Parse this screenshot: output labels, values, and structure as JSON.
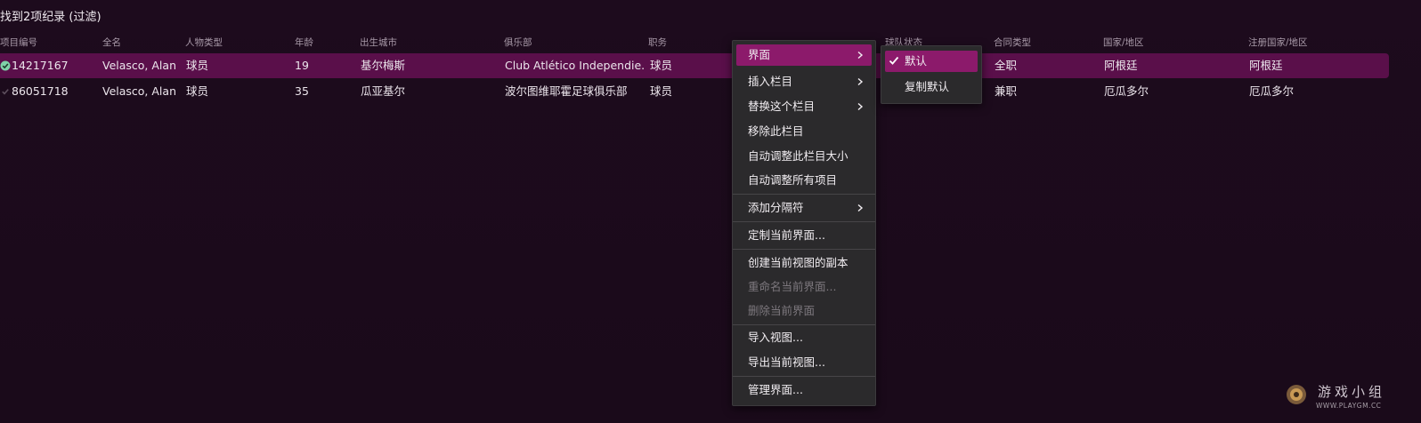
{
  "result_count": "找到2项纪录 (过滤)",
  "columns": [
    {
      "label": "项目编号"
    },
    {
      "label": "全名"
    },
    {
      "label": "人物类型"
    },
    {
      "label": "年龄"
    },
    {
      "label": "出生城市"
    },
    {
      "label": "俱乐部"
    },
    {
      "label": "职务"
    },
    {
      "label": "球队状态"
    },
    {
      "label": "合同类型"
    },
    {
      "label": "国家/地区"
    },
    {
      "label": "注册国家/地区"
    }
  ],
  "rows": [
    {
      "id": "14217167",
      "name": "Velasco, Alan",
      "type": "球员",
      "age": "19",
      "city": "基尔梅斯",
      "club": "Club Atlético Independie...",
      "role": "球员",
      "contract": "全职",
      "country": "阿根廷",
      "reg_country": "阿根廷",
      "checked": true
    },
    {
      "id": "86051718",
      "name": "Velasco, Alan",
      "type": "球员",
      "age": "35",
      "city": "瓜亚基尔",
      "club": "波尔图维耶霍足球俱乐部",
      "role": "球员",
      "contract": "兼职",
      "country": "厄瓜多尔",
      "reg_country": "厄瓜多尔",
      "checked": false
    }
  ],
  "menu": {
    "items": [
      {
        "label": "界面",
        "submenu": true,
        "active": true
      },
      {
        "label": "插入栏目",
        "submenu": true
      },
      {
        "label": "替换这个栏目",
        "submenu": true
      },
      {
        "label": "移除此栏目"
      },
      {
        "label": "自动调整此栏目大小"
      },
      {
        "label": "自动调整所有项目"
      },
      {
        "label": "添加分隔符",
        "submenu": true
      },
      {
        "label": "定制当前界面..."
      },
      {
        "label": "创建当前视图的副本"
      },
      {
        "label": "重命名当前界面...",
        "disabled": true
      },
      {
        "label": "删除当前界面",
        "disabled": true
      },
      {
        "label": "导入视图..."
      },
      {
        "label": "导出当前视图..."
      },
      {
        "label": "管理界面..."
      }
    ]
  },
  "submenu": {
    "items": [
      {
        "label": "默认",
        "checked": true
      },
      {
        "label": "复制默认"
      }
    ]
  },
  "watermark": {
    "text": "游戏小组",
    "url": "WWW.PLAYGM.CC"
  },
  "colors": {
    "accent": "#8c1a6b",
    "selected_row": "#5a0f4a",
    "check": "#7fd3a8",
    "menu_bg": "#2b2a2c"
  }
}
